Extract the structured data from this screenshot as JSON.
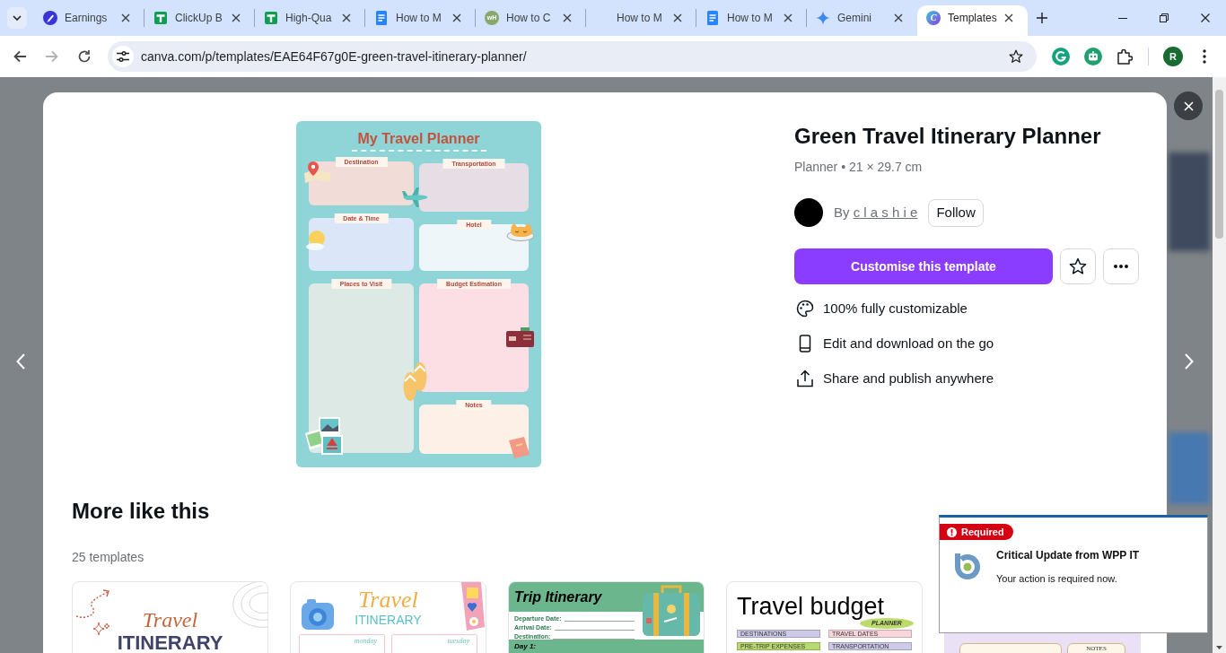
{
  "browser": {
    "tabs": [
      {
        "title": "Earnings",
        "kind": "brush",
        "selected": false
      },
      {
        "title": "ClickUp B",
        "kind": "sheet",
        "selected": false
      },
      {
        "title": "High-Qua",
        "kind": "sheet",
        "selected": false
      },
      {
        "title": "How to M",
        "kind": "doc",
        "selected": false
      },
      {
        "title": "How to C",
        "kind": "site",
        "letters": "wH",
        "selected": false
      },
      {
        "title": "How to M",
        "kind": "none",
        "selected": false
      },
      {
        "title": "How to M",
        "kind": "doc",
        "selected": false
      },
      {
        "title": "Gemini",
        "kind": "spark",
        "selected": false
      },
      {
        "title": "Templates",
        "kind": "canva",
        "letters": "C",
        "selected": true
      }
    ],
    "forward_disabled": true,
    "url": "canva.com/p/templates/EAE64F67g0E-green-travel-itinerary-planner/",
    "profile_initial": "R"
  },
  "preview": {
    "title": "My Travel Planner",
    "left_sections": [
      "Destination",
      "Date & Time",
      "Places to Visit"
    ],
    "right_sections": [
      "Transportation",
      "Hotel",
      "Budget Estimation",
      "Notes"
    ]
  },
  "template": {
    "title": "Green Travel Itinerary Planner",
    "meta": "Planner • 21 × 29.7 cm",
    "by": "By",
    "author": "c l a s h i e",
    "follow": "Follow",
    "primary_action": "Customise this template",
    "features": [
      {
        "kind": "palette",
        "text": "100% fully customizable"
      },
      {
        "kind": "phone",
        "text": "Edit and download on the go"
      },
      {
        "kind": "share",
        "text": "Share and publish anywhere"
      }
    ]
  },
  "more_like_this": {
    "heading": "More like this",
    "count": "25 templates",
    "cards": [
      {
        "kind": "script",
        "title": "Travel",
        "subtitle": "ITINERARY"
      },
      {
        "kind": "camera",
        "title": "Travel",
        "subtitle": "ITINERARY",
        "days": [
          "monday",
          "tuesday"
        ]
      },
      {
        "kind": "trip",
        "title": "Trip Itinerary",
        "fields": [
          "Departure Date:",
          "Arrival Date:",
          "Destination:"
        ],
        "day": "Day 1:"
      },
      {
        "kind": "budget",
        "title": "Travel budget",
        "badge": "PLANNER",
        "labels": [
          "DESTINATIONS",
          "TRAVEL DATES",
          "PRE-TRIP EXPENSES",
          "TRANSPORTATION"
        ]
      },
      {
        "kind": "notes",
        "label": "NOTES"
      }
    ]
  },
  "notification": {
    "badge": "Required",
    "title": "Critical Update from WPP IT",
    "message": "Your action is required now."
  }
}
